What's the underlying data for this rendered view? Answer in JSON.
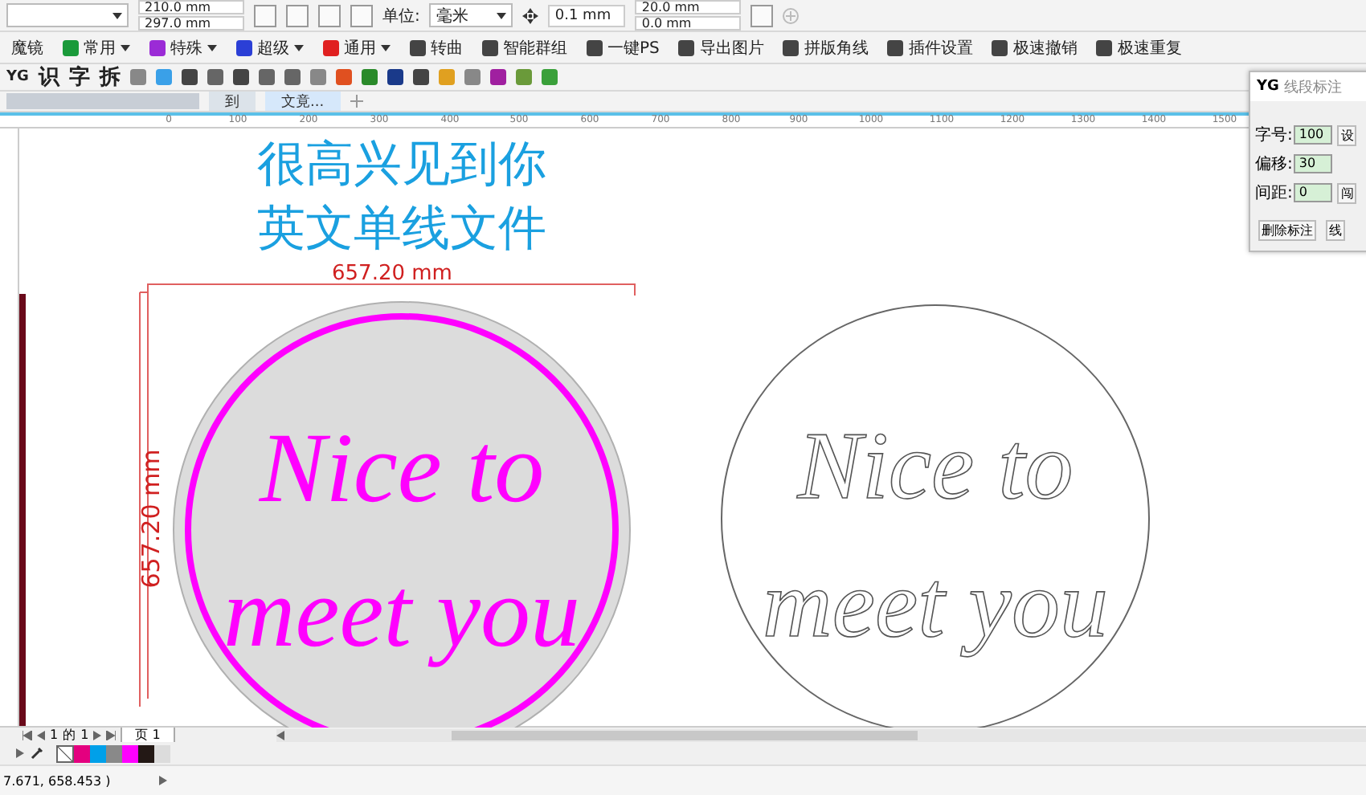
{
  "property_bar": {
    "page_width": "210.0 mm",
    "page_height": "297.0 mm",
    "unit_label": "单位:",
    "unit": "毫米",
    "nudge": "0.1 mm",
    "dup_x": "20.0 mm",
    "dup_y": "0.0 mm"
  },
  "plugin_toolbar": [
    {
      "label": "魔镜",
      "kind": "plain"
    },
    {
      "label": "常用",
      "kind": "menu",
      "color": "#1a9a3a"
    },
    {
      "label": "特殊",
      "kind": "menu",
      "color": "#9b2bd6"
    },
    {
      "label": "超级",
      "kind": "menu",
      "color": "#2b3fd6"
    },
    {
      "label": "通用",
      "kind": "menu",
      "color": "#e02020"
    },
    {
      "label": "转曲",
      "kind": "action"
    },
    {
      "label": "智能群组",
      "kind": "action"
    },
    {
      "label": "一键PS",
      "kind": "action"
    },
    {
      "label": "导出图片",
      "kind": "action"
    },
    {
      "label": "拼版角线",
      "kind": "action"
    },
    {
      "label": "插件设置",
      "kind": "action"
    },
    {
      "label": "极速撤销",
      "kind": "action"
    },
    {
      "label": "极速重复",
      "kind": "action"
    }
  ],
  "tool_row": {
    "logo": "YG",
    "chars": [
      "识",
      "字",
      "拆"
    ]
  },
  "doc_tabs": [
    {
      "label": "到",
      "selected": false
    },
    {
      "label": "文竟...",
      "selected": true
    }
  ],
  "ruler_labels": [
    "0",
    "100",
    "200",
    "300",
    "400",
    "500",
    "600",
    "700",
    "800",
    "900",
    "1000",
    "1100",
    "1200",
    "1300",
    "1400",
    "1500"
  ],
  "canvas": {
    "title_lines": [
      "很高兴见到你",
      "英文单线文件"
    ],
    "width_dimension": "657.20 mm",
    "height_dimension": "657.20 mm",
    "left_art": [
      "Nice to",
      "meet you"
    ],
    "right_art": [
      "Nice to",
      "meet you"
    ]
  },
  "panel": {
    "logo": "YG",
    "title": "线段标注",
    "fields": [
      {
        "label": "字号:",
        "value": "100",
        "button": "设"
      },
      {
        "label": "偏移:",
        "value": "30"
      },
      {
        "label": "间距:",
        "value": "0",
        "button": "闯"
      }
    ],
    "buttons": [
      "删除标注",
      "线"
    ]
  },
  "page_nav": {
    "current": "1",
    "of": "的",
    "total": "1",
    "tab": "页 1"
  },
  "palette": [
    {
      "color": "#e4007f"
    },
    {
      "color": "#00a0e9"
    },
    {
      "color": "#898989"
    },
    {
      "color": "#ff00ff"
    },
    {
      "color": "#231815"
    },
    {
      "color": "#dcdcdc"
    }
  ],
  "status_bar": {
    "coordinates": "7.671, 658.453 )"
  }
}
